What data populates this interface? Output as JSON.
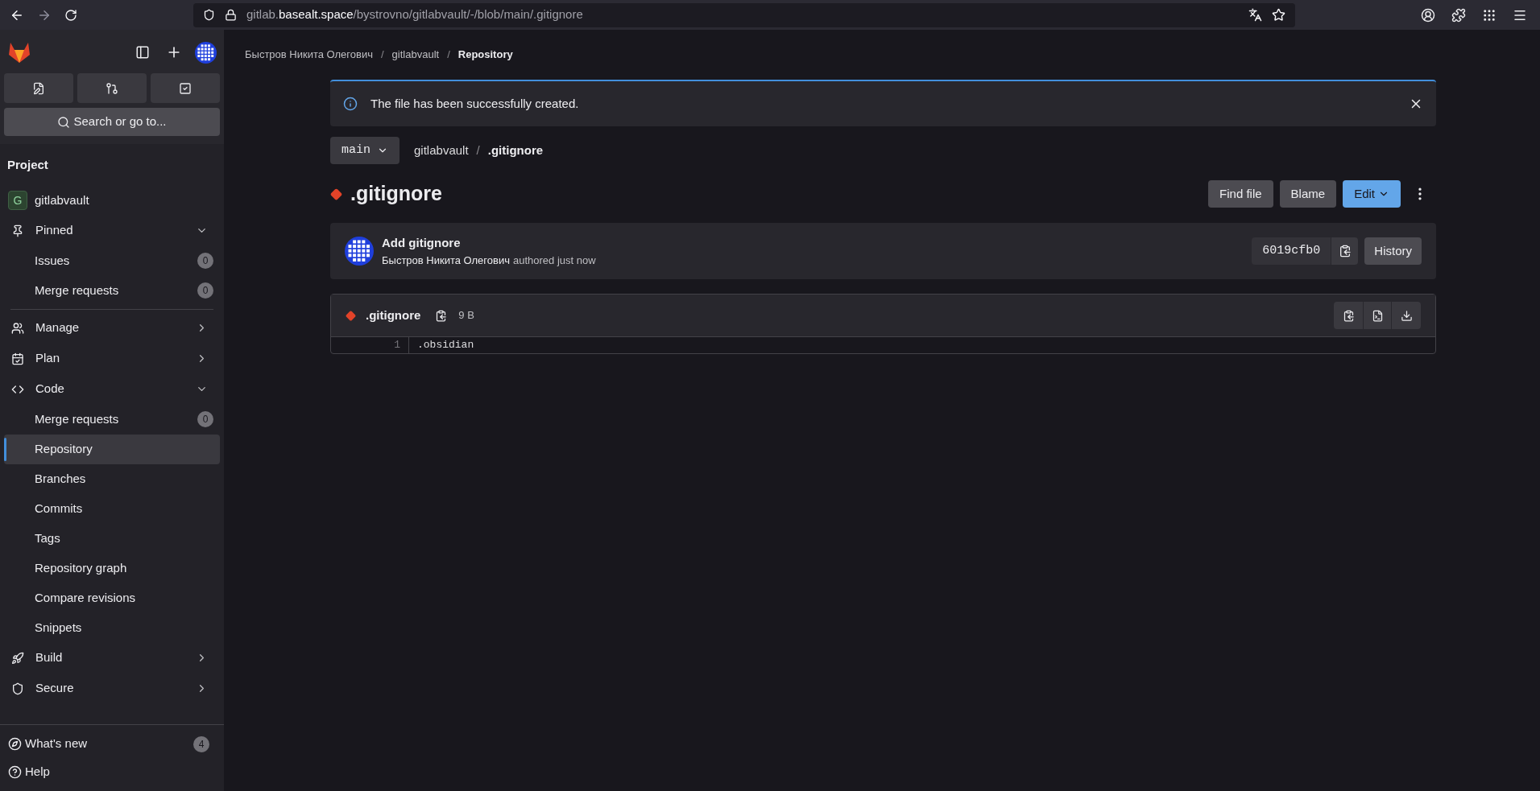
{
  "browser": {
    "url": [
      {
        "text": "gitlab.",
        "strong": false
      },
      {
        "text": "basealt.space",
        "strong": true
      },
      {
        "text": "/bystrovno/gitlabvault/-/blob/main/.gitignore",
        "strong": false
      }
    ]
  },
  "sidebar": {
    "search_placeholder": "Search or go to...",
    "section": "Project",
    "project": {
      "initial": "G",
      "name": "gitlabvault"
    },
    "items": [
      {
        "label": "Pinned",
        "expanded": true,
        "children": [
          {
            "label": "Issues",
            "count": "0",
            "selected": false
          },
          {
            "label": "Merge requests",
            "count": "0",
            "selected": false
          }
        ]
      },
      {
        "label": "Manage",
        "expanded": false
      },
      {
        "label": "Plan",
        "expanded": false
      },
      {
        "label": "Code",
        "expanded": true,
        "children": [
          {
            "label": "Merge requests",
            "count": "0",
            "selected": false
          },
          {
            "label": "Repository",
            "selected": true
          },
          {
            "label": "Branches",
            "selected": false
          },
          {
            "label": "Commits",
            "selected": false
          },
          {
            "label": "Tags",
            "selected": false
          },
          {
            "label": "Repository graph",
            "selected": false
          },
          {
            "label": "Compare revisions",
            "selected": false
          },
          {
            "label": "Snippets",
            "selected": false
          }
        ]
      },
      {
        "label": "Build",
        "expanded": false
      },
      {
        "label": "Secure",
        "expanded": false
      }
    ],
    "footer": [
      {
        "label": "What's new",
        "count": "4"
      },
      {
        "label": "Help"
      }
    ]
  },
  "breadcrumbs": [
    {
      "label": "Быстров Никита Олегович",
      "current": false
    },
    {
      "separator": "/",
      "label": "gitlabvault",
      "current": false
    },
    {
      "separator": "/",
      "label": "Repository",
      "current": true
    }
  ],
  "alert": {
    "message": "The file has been successfully created."
  },
  "branch": "main",
  "path": [
    {
      "label": "gitlabvault",
      "current": false
    },
    {
      "separator": "/",
      "label": ".gitignore",
      "current": true
    }
  ],
  "title": ".gitignore",
  "actions": [
    {
      "label": "Find file",
      "kind": "default"
    },
    {
      "label": "Blame",
      "kind": "default"
    },
    {
      "label": "Edit",
      "kind": "primary"
    }
  ],
  "commit": {
    "title": "Add gitignore",
    "author": "Быстров Никита Олегович",
    "meta": "authored just now",
    "sha": "6019cfb0",
    "history": "History"
  },
  "file": {
    "name": ".gitignore",
    "size": "9 B",
    "lines": [
      {
        "number": "1",
        "text": ".obsidian"
      }
    ]
  }
}
